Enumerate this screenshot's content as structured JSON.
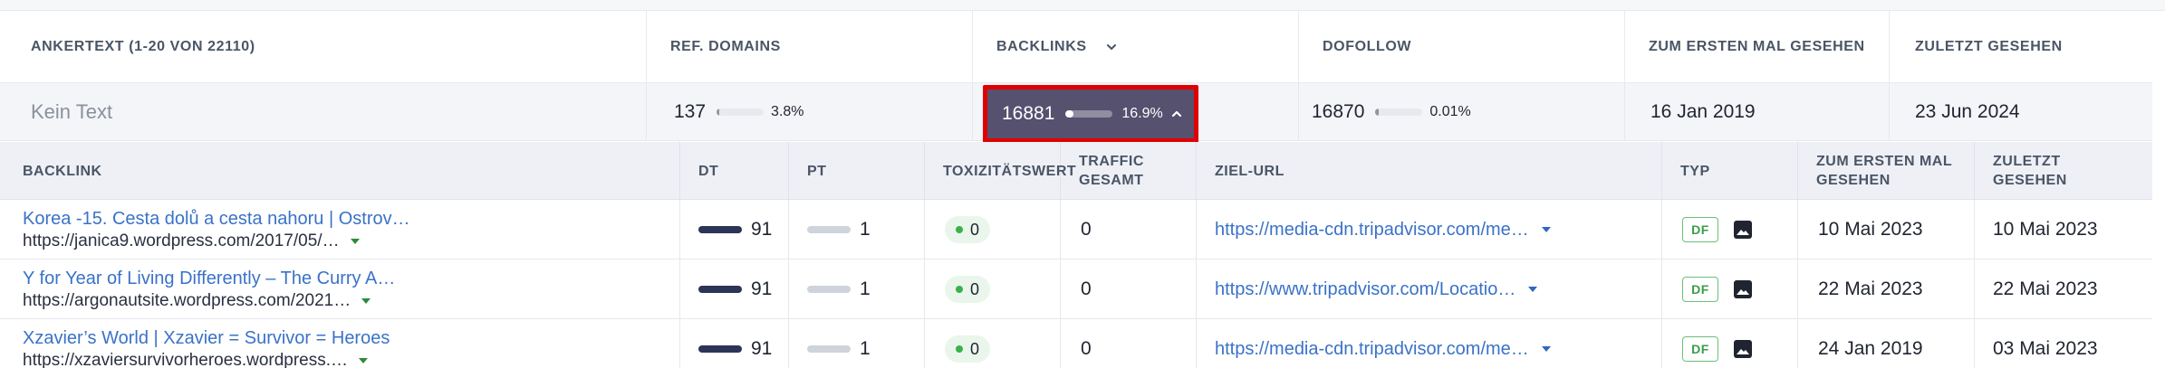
{
  "outer_header": {
    "anchor": "ANKERTEXT (1-20 VON 22110)",
    "ref_domains": "REF. DOMAINS",
    "backlinks": "BACKLINKS",
    "dofollow": "DOFOLLOW",
    "first_seen": "ZUM ERSTEN MAL GESEHEN",
    "last_seen": "ZULETZT GESEHEN"
  },
  "summary": {
    "anchor_text": "Kein Text",
    "ref_domains": {
      "value": "137",
      "pct": "3.8%",
      "fraction": 0.038
    },
    "backlinks": {
      "value": "16881",
      "pct": "16.9%",
      "fraction": 0.169
    },
    "dofollow": {
      "value": "16870",
      "pct": "0.01%",
      "fraction": 0.0001
    },
    "first_seen": "16 Jan 2019",
    "last_seen": "23 Jun 2024"
  },
  "inner_header": {
    "backlink": "BACKLINK",
    "dt": "DT",
    "pt": "PT",
    "toxicity": "TOXIZITÄTSWERT",
    "traffic": "TRAFFIC GESAMT",
    "target_url": "ZIEL-URL",
    "type": "TYP",
    "first_seen": "ZUM ERSTEN MAL GESEHEN",
    "last_seen": "ZULETZT GESEHEN"
  },
  "rows": [
    {
      "title": "Korea -15. Cesta dolů a cesta nahoru | Ostrov…",
      "url": "https://janica9.wordpress.com/2017/05/…",
      "dt": "91",
      "pt": "1",
      "toxicity": "0",
      "traffic": "0",
      "target": "https://media-cdn.tripadvisor.com/me…",
      "type": "DF",
      "first_seen": "10 Mai 2023",
      "last_seen": "10 Mai 2023"
    },
    {
      "title": "Y for Year of Living Differently – The Curry A…",
      "url": "https://argonautsite.wordpress.com/2021…",
      "dt": "91",
      "pt": "1",
      "toxicity": "0",
      "traffic": "0",
      "target": "https://www.tripadvisor.com/Locatio…",
      "type": "DF",
      "first_seen": "22 Mai 2023",
      "last_seen": "22 Mai 2023"
    },
    {
      "title": "Xzavier’s World | Xzavier = Survivor = Heroes",
      "url": "https://xzaviersurvivorheroes.wordpress.…",
      "dt": "91",
      "pt": "1",
      "toxicity": "0",
      "traffic": "0",
      "target": "https://media-cdn.tripadvisor.com/me…",
      "type": "DF",
      "first_seen": "24 Jan 2019",
      "last_seen": "03 Mai 2023"
    }
  ],
  "icons": {
    "sort": "chevron-down-icon",
    "expand": "chevron-up-icon",
    "dropdown": "caret-down-icon",
    "image": "image-icon"
  },
  "colors": {
    "highlight_border": "#e00000",
    "highlight_bg": "#55516f",
    "link": "#3a72c8",
    "dofollow_green": "#3a9d4b",
    "dt_bar": "#2c3556"
  }
}
